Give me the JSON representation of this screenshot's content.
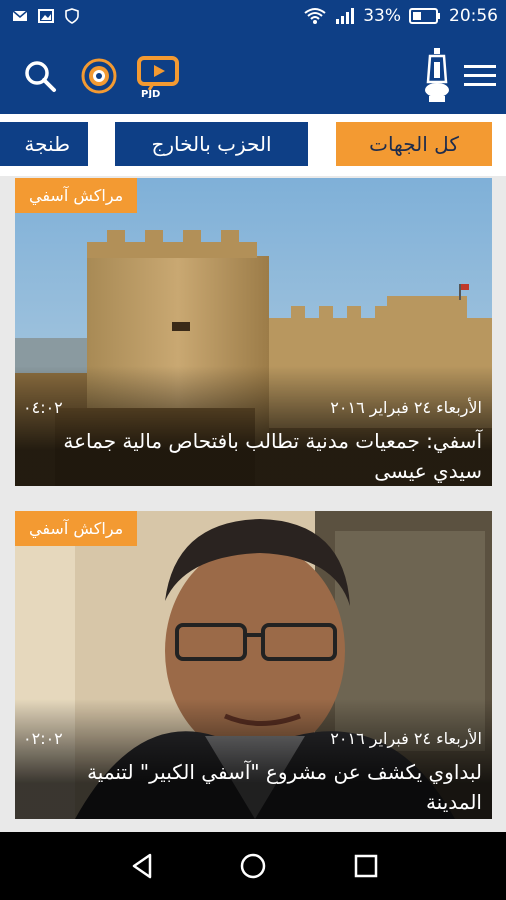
{
  "status_bar": {
    "battery_percent": "33%",
    "time": "20:56",
    "icons": [
      "mail-icon",
      "gallery-icon",
      "shield-icon",
      "wifi-icon",
      "signal-icon",
      "battery-icon"
    ]
  },
  "app_bar": {
    "logo_text": "PJD",
    "icons": [
      "search-icon",
      "compass-icon",
      "pjd-tv-logo",
      "party-lamp-logo",
      "menu-icon"
    ]
  },
  "tabs": [
    {
      "label": "كل الجهات"
    },
    {
      "label": "الحزب بالخارج"
    },
    {
      "label": "طنجة"
    }
  ],
  "articles": [
    {
      "category": "مراكش آسفي",
      "date": "الأربعاء ٢٤ فبراير ٢٠١٦",
      "time": "٠٤:٠٢",
      "title": "آسفي: جمعيات مدنية تطالب بافتحاص مالية جماعة سيدي عيسى"
    },
    {
      "category": "مراكش آسفي",
      "date": "الأربعاء ٢٤ فبراير ٢٠١٦",
      "time": "٠٢:٠٢",
      "title": "لبداوي يكشف عن مشروع \"آسفي الكبير\" لتنمية المدينة"
    }
  ],
  "colors": {
    "primary": "#0e3f86",
    "accent": "#f39a32"
  }
}
